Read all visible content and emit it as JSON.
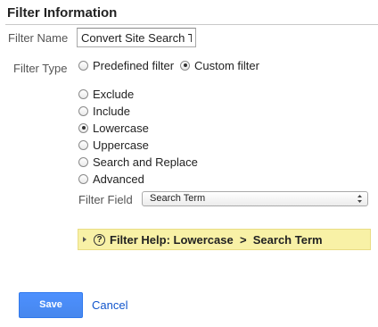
{
  "section": {
    "title": "Filter Information"
  },
  "filter_name": {
    "label": "Filter Name",
    "value": "Convert Site Search Te"
  },
  "filter_type": {
    "label": "Filter Type",
    "predefined_label": "Predefined filter",
    "custom_label": "Custom filter",
    "selected": "custom"
  },
  "custom_options": {
    "items": [
      "Exclude",
      "Include",
      "Lowercase",
      "Uppercase",
      "Search and Replace",
      "Advanced"
    ],
    "selected": "Lowercase"
  },
  "filter_field": {
    "label": "Filter Field",
    "selected_value": "Search Term"
  },
  "help": {
    "prefix": "Filter Help: ",
    "filter": "Lowercase",
    "separator": "  >  ",
    "field": "Search Term"
  },
  "actions": {
    "save_label": "Save",
    "cancel_label": "Cancel"
  },
  "colors": {
    "primary_button": "#4d90fe",
    "help_bar": "#f8f1a6",
    "link": "#1155cc"
  }
}
